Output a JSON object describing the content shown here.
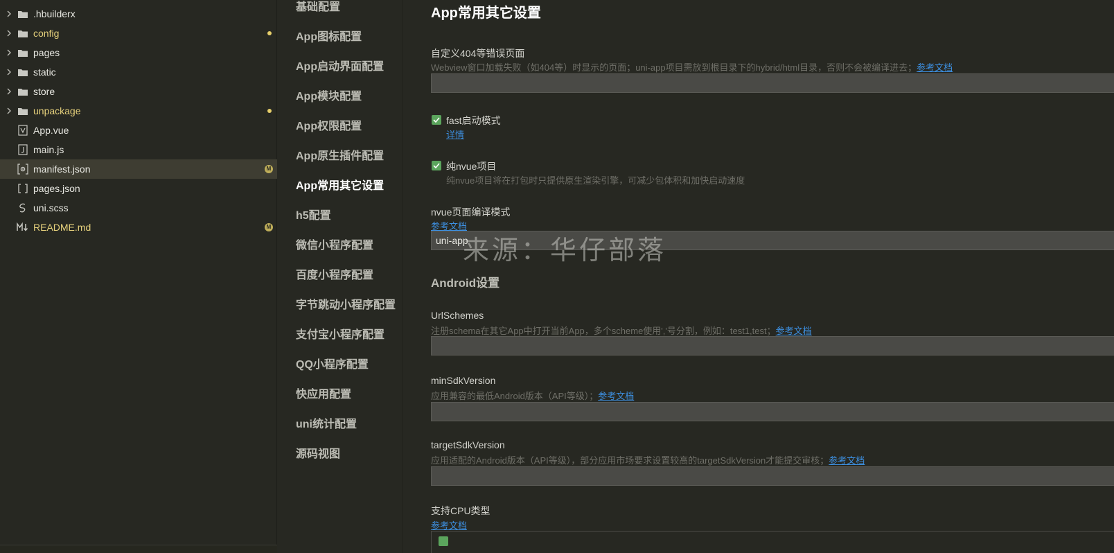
{
  "explorer": {
    "items": [
      {
        "name": ".hbuilderx",
        "type": "folder",
        "status": ""
      },
      {
        "name": "config",
        "type": "folder",
        "status": "dot"
      },
      {
        "name": "pages",
        "type": "folder",
        "status": ""
      },
      {
        "name": "static",
        "type": "folder",
        "status": ""
      },
      {
        "name": "store",
        "type": "folder",
        "status": ""
      },
      {
        "name": "unpackage",
        "type": "folder",
        "status": "dot"
      },
      {
        "name": "App.vue",
        "type": "vue-file",
        "status": ""
      },
      {
        "name": "main.js",
        "type": "js-file",
        "status": ""
      },
      {
        "name": "manifest.json",
        "type": "json-file",
        "status": "M"
      },
      {
        "name": "pages.json",
        "type": "json-file",
        "status": ""
      },
      {
        "name": "uni.scss",
        "type": "scss-file",
        "status": ""
      },
      {
        "name": "README.md",
        "type": "md-file",
        "status": "M"
      }
    ],
    "modified_badge": "M"
  },
  "nav": {
    "items": [
      "基础配置",
      "App图标配置",
      "App启动界面配置",
      "App模块配置",
      "App权限配置",
      "App原生插件配置",
      "App常用其它设置",
      "h5配置",
      "微信小程序配置",
      "百度小程序配置",
      "字节跳动小程序配置",
      "支付宝小程序配置",
      "QQ小程序配置",
      "快应用配置",
      "uni统计配置",
      "源码视图"
    ],
    "active_index": 6
  },
  "main": {
    "title": "App常用其它设置",
    "error_page": {
      "label": "自定义404等错误页面",
      "desc": "Webview窗口加载失败（如404等）时显示的页面；uni-app项目需放到根目录下的hybrid/html目录，否则不会被编译进去；",
      "link": "参考文档",
      "value": ""
    },
    "fast_mode": {
      "label": "fast启动模式",
      "checked": true,
      "link": "详情"
    },
    "pure_nvue": {
      "label": "纯nvue项目",
      "checked": true,
      "desc": "纯nvue项目将在打包时只提供原生渲染引擎，可减少包体积和加快启动速度"
    },
    "nvue_compile": {
      "label": "nvue页面编译模式",
      "link": "参考文档",
      "value": "uni-app"
    },
    "android_heading": "Android设置",
    "url_schemes": {
      "label": "UrlSchemes",
      "desc": "注册schema在其它App中打开当前App，多个scheme使用','号分割，例如：test1,test；",
      "link": "参考文档",
      "value": ""
    },
    "min_sdk": {
      "label": "minSdkVersion",
      "desc": "应用兼容的最低Android版本（API等级）；",
      "link": "参考文档",
      "value": ""
    },
    "target_sdk": {
      "label": "targetSdkVersion",
      "desc": "应用适配的Android版本（API等级），部分应用市场要求设置较高的targetSdkVersion才能提交审核；",
      "link": "参考文档",
      "value": ""
    },
    "cpu_types": {
      "label": "支持CPU类型",
      "link": "参考文档"
    }
  },
  "watermark": "来源：华仔部落",
  "colors": {
    "background": "#272822",
    "active_row": "#3e3d32",
    "link": "#3d8fe0",
    "checkbox": "#5ba55d",
    "modified": "#e6d17c"
  }
}
